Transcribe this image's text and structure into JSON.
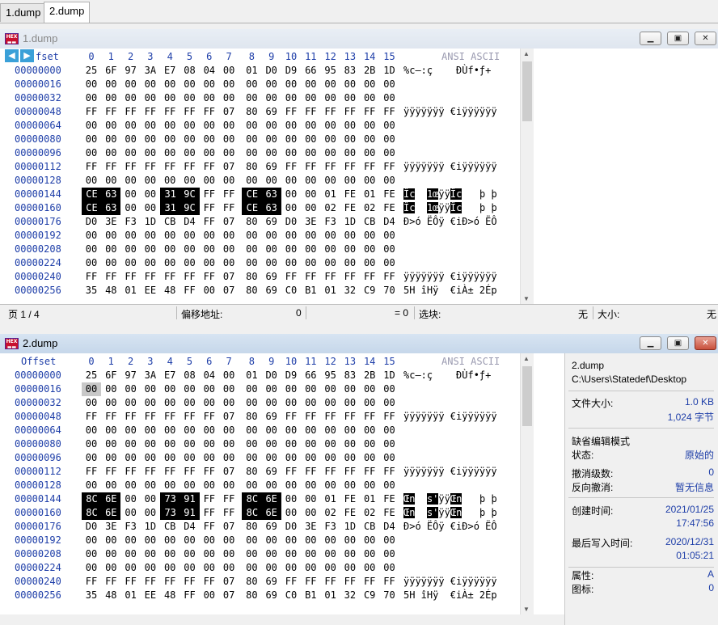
{
  "tabs": [
    "1.dump",
    "2.dump"
  ],
  "window1": {
    "title": "1.dump"
  },
  "window2": {
    "title": "2.dump"
  },
  "header": {
    "offset": "Offset",
    "columns": [
      "0",
      "1",
      "2",
      "3",
      "4",
      "5",
      "6",
      "7",
      "8",
      "9",
      "10",
      "11",
      "12",
      "13",
      "14",
      "15"
    ],
    "ascii": "ANSI ASCII"
  },
  "dump1": {
    "rows": [
      {
        "offset": "00000000",
        "hex": [
          "25",
          "6F",
          "97",
          "3A",
          "E7",
          "08",
          "04",
          "00",
          "01",
          "D0",
          "D9",
          "66",
          "95",
          "83",
          "2B",
          "1D"
        ],
        "ascii": "%c—:ç    ÐÙf•ƒ+ "
      },
      {
        "offset": "00000016",
        "hex": [
          "00",
          "00",
          "00",
          "00",
          "00",
          "00",
          "00",
          "00",
          "00",
          "00",
          "00",
          "00",
          "00",
          "00",
          "00",
          "00"
        ],
        "ascii": ""
      },
      {
        "offset": "00000032",
        "hex": [
          "00",
          "00",
          "00",
          "00",
          "00",
          "00",
          "00",
          "00",
          "00",
          "00",
          "00",
          "00",
          "00",
          "00",
          "00",
          "00"
        ],
        "ascii": ""
      },
      {
        "offset": "00000048",
        "hex": [
          "FF",
          "FF",
          "FF",
          "FF",
          "FF",
          "FF",
          "FF",
          "07",
          "80",
          "69",
          "FF",
          "FF",
          "FF",
          "FF",
          "FF",
          "FF"
        ],
        "ascii": "ÿÿÿÿÿÿÿ €iÿÿÿÿÿÿ"
      },
      {
        "offset": "00000064",
        "hex": [
          "00",
          "00",
          "00",
          "00",
          "00",
          "00",
          "00",
          "00",
          "00",
          "00",
          "00",
          "00",
          "00",
          "00",
          "00",
          "00"
        ],
        "ascii": ""
      },
      {
        "offset": "00000080",
        "hex": [
          "00",
          "00",
          "00",
          "00",
          "00",
          "00",
          "00",
          "00",
          "00",
          "00",
          "00",
          "00",
          "00",
          "00",
          "00",
          "00"
        ],
        "ascii": ""
      },
      {
        "offset": "00000096",
        "hex": [
          "00",
          "00",
          "00",
          "00",
          "00",
          "00",
          "00",
          "00",
          "00",
          "00",
          "00",
          "00",
          "00",
          "00",
          "00",
          "00"
        ],
        "ascii": ""
      },
      {
        "offset": "00000112",
        "hex": [
          "FF",
          "FF",
          "FF",
          "FF",
          "FF",
          "FF",
          "FF",
          "07",
          "80",
          "69",
          "FF",
          "FF",
          "FF",
          "FF",
          "FF",
          "FF"
        ],
        "ascii": "ÿÿÿÿÿÿÿ €iÿÿÿÿÿÿ"
      },
      {
        "offset": "00000128",
        "hex": [
          "00",
          "00",
          "00",
          "00",
          "00",
          "00",
          "00",
          "00",
          "00",
          "00",
          "00",
          "00",
          "00",
          "00",
          "00",
          "00"
        ],
        "ascii": ""
      },
      {
        "offset": "00000144",
        "hex": [
          "CE",
          "63",
          "00",
          "00",
          "31",
          "9C",
          "FF",
          "FF",
          "CE",
          "63",
          "00",
          "00",
          "01",
          "FE",
          "01",
          "FE"
        ],
        "ascii": "Îc  1œÿÿÎc   þ þ",
        "sel": [
          0,
          1,
          4,
          5,
          8,
          9
        ]
      },
      {
        "offset": "00000160",
        "hex": [
          "CE",
          "63",
          "00",
          "00",
          "31",
          "9C",
          "FF",
          "FF",
          "CE",
          "63",
          "00",
          "00",
          "02",
          "FE",
          "02",
          "FE"
        ],
        "ascii": "Îc  1œÿÿÎc   þ þ",
        "sel": [
          0,
          1,
          4,
          5,
          8,
          9
        ]
      },
      {
        "offset": "00000176",
        "hex": [
          "D0",
          "3E",
          "F3",
          "1D",
          "CB",
          "D4",
          "FF",
          "07",
          "80",
          "69",
          "D0",
          "3E",
          "F3",
          "1D",
          "CB",
          "D4"
        ],
        "ascii": "Ð>ó ËÔÿ €iÐ>ó ËÔ"
      },
      {
        "offset": "00000192",
        "hex": [
          "00",
          "00",
          "00",
          "00",
          "00",
          "00",
          "00",
          "00",
          "00",
          "00",
          "00",
          "00",
          "00",
          "00",
          "00",
          "00"
        ],
        "ascii": ""
      },
      {
        "offset": "00000208",
        "hex": [
          "00",
          "00",
          "00",
          "00",
          "00",
          "00",
          "00",
          "00",
          "00",
          "00",
          "00",
          "00",
          "00",
          "00",
          "00",
          "00"
        ],
        "ascii": ""
      },
      {
        "offset": "00000224",
        "hex": [
          "00",
          "00",
          "00",
          "00",
          "00",
          "00",
          "00",
          "00",
          "00",
          "00",
          "00",
          "00",
          "00",
          "00",
          "00",
          "00"
        ],
        "ascii": ""
      },
      {
        "offset": "00000240",
        "hex": [
          "FF",
          "FF",
          "FF",
          "FF",
          "FF",
          "FF",
          "FF",
          "07",
          "80",
          "69",
          "FF",
          "FF",
          "FF",
          "FF",
          "FF",
          "FF"
        ],
        "ascii": "ÿÿÿÿÿÿÿ €iÿÿÿÿÿÿ"
      },
      {
        "offset": "00000256",
        "hex": [
          "35",
          "48",
          "01",
          "EE",
          "48",
          "FF",
          "00",
          "07",
          "80",
          "69",
          "C0",
          "B1",
          "01",
          "32",
          "C9",
          "70"
        ],
        "ascii": "5H îHÿ  €iÀ± 2Ép"
      }
    ]
  },
  "dump2": {
    "rows": [
      {
        "offset": "00000000",
        "hex": [
          "25",
          "6F",
          "97",
          "3A",
          "E7",
          "08",
          "04",
          "00",
          "01",
          "D0",
          "D9",
          "66",
          "95",
          "83",
          "2B",
          "1D"
        ],
        "ascii": "%c—:ç    ÐÙf•ƒ+ "
      },
      {
        "offset": "00000016",
        "hex": [
          "00",
          "00",
          "00",
          "00",
          "00",
          "00",
          "00",
          "00",
          "00",
          "00",
          "00",
          "00",
          "00",
          "00",
          "00",
          "00"
        ],
        "ascii": "",
        "cursor": 0
      },
      {
        "offset": "00000032",
        "hex": [
          "00",
          "00",
          "00",
          "00",
          "00",
          "00",
          "00",
          "00",
          "00",
          "00",
          "00",
          "00",
          "00",
          "00",
          "00",
          "00"
        ],
        "ascii": ""
      },
      {
        "offset": "00000048",
        "hex": [
          "FF",
          "FF",
          "FF",
          "FF",
          "FF",
          "FF",
          "FF",
          "07",
          "80",
          "69",
          "FF",
          "FF",
          "FF",
          "FF",
          "FF",
          "FF"
        ],
        "ascii": "ÿÿÿÿÿÿÿ €iÿÿÿÿÿÿ"
      },
      {
        "offset": "00000064",
        "hex": [
          "00",
          "00",
          "00",
          "00",
          "00",
          "00",
          "00",
          "00",
          "00",
          "00",
          "00",
          "00",
          "00",
          "00",
          "00",
          "00"
        ],
        "ascii": ""
      },
      {
        "offset": "00000080",
        "hex": [
          "00",
          "00",
          "00",
          "00",
          "00",
          "00",
          "00",
          "00",
          "00",
          "00",
          "00",
          "00",
          "00",
          "00",
          "00",
          "00"
        ],
        "ascii": ""
      },
      {
        "offset": "00000096",
        "hex": [
          "00",
          "00",
          "00",
          "00",
          "00",
          "00",
          "00",
          "00",
          "00",
          "00",
          "00",
          "00",
          "00",
          "00",
          "00",
          "00"
        ],
        "ascii": ""
      },
      {
        "offset": "00000112",
        "hex": [
          "FF",
          "FF",
          "FF",
          "FF",
          "FF",
          "FF",
          "FF",
          "07",
          "80",
          "69",
          "FF",
          "FF",
          "FF",
          "FF",
          "FF",
          "FF"
        ],
        "ascii": "ÿÿÿÿÿÿÿ €iÿÿÿÿÿÿ"
      },
      {
        "offset": "00000128",
        "hex": [
          "00",
          "00",
          "00",
          "00",
          "00",
          "00",
          "00",
          "00",
          "00",
          "00",
          "00",
          "00",
          "00",
          "00",
          "00",
          "00"
        ],
        "ascii": ""
      },
      {
        "offset": "00000144",
        "hex": [
          "8C",
          "6E",
          "00",
          "00",
          "73",
          "91",
          "FF",
          "FF",
          "8C",
          "6E",
          "00",
          "00",
          "01",
          "FE",
          "01",
          "FE"
        ],
        "ascii": "Œn  s'ÿÿŒn   þ þ",
        "sel": [
          0,
          1,
          4,
          5,
          8,
          9
        ]
      },
      {
        "offset": "00000160",
        "hex": [
          "8C",
          "6E",
          "00",
          "00",
          "73",
          "91",
          "FF",
          "FF",
          "8C",
          "6E",
          "00",
          "00",
          "02",
          "FE",
          "02",
          "FE"
        ],
        "ascii": "Œn  s'ÿÿŒn   þ þ",
        "sel": [
          0,
          1,
          4,
          5,
          8,
          9
        ]
      },
      {
        "offset": "00000176",
        "hex": [
          "D0",
          "3E",
          "F3",
          "1D",
          "CB",
          "D4",
          "FF",
          "07",
          "80",
          "69",
          "D0",
          "3E",
          "F3",
          "1D",
          "CB",
          "D4"
        ],
        "ascii": "Ð>ó ËÔÿ €iÐ>ó ËÔ"
      },
      {
        "offset": "00000192",
        "hex": [
          "00",
          "00",
          "00",
          "00",
          "00",
          "00",
          "00",
          "00",
          "00",
          "00",
          "00",
          "00",
          "00",
          "00",
          "00",
          "00"
        ],
        "ascii": ""
      },
      {
        "offset": "00000208",
        "hex": [
          "00",
          "00",
          "00",
          "00",
          "00",
          "00",
          "00",
          "00",
          "00",
          "00",
          "00",
          "00",
          "00",
          "00",
          "00",
          "00"
        ],
        "ascii": ""
      },
      {
        "offset": "00000224",
        "hex": [
          "00",
          "00",
          "00",
          "00",
          "00",
          "00",
          "00",
          "00",
          "00",
          "00",
          "00",
          "00",
          "00",
          "00",
          "00",
          "00"
        ],
        "ascii": ""
      },
      {
        "offset": "00000240",
        "hex": [
          "FF",
          "FF",
          "FF",
          "FF",
          "FF",
          "FF",
          "FF",
          "07",
          "80",
          "69",
          "FF",
          "FF",
          "FF",
          "FF",
          "FF",
          "FF"
        ],
        "ascii": "ÿÿÿÿÿÿÿ €iÿÿÿÿÿÿ"
      },
      {
        "offset": "00000256",
        "hex": [
          "35",
          "48",
          "01",
          "EE",
          "48",
          "FF",
          "00",
          "07",
          "80",
          "69",
          "C0",
          "B1",
          "01",
          "32",
          "C9",
          "70"
        ],
        "ascii": "5H îHÿ  €iÀ± 2Ép"
      }
    ]
  },
  "status1": {
    "page": "页 1 / 4",
    "offset_label": "偏移地址:",
    "offset_value": "0",
    "eq": "= 0",
    "block_label": "选块:",
    "block_value": "无",
    "size_label": "大小:",
    "size_value": "无"
  },
  "info": {
    "filename": "2.dump",
    "path": "C:\\Users\\Statedef\\Desktop",
    "size_label": "文件大小:",
    "size_kb": "1.0 KB",
    "size_bytes": "1,024 字节",
    "mode_title": "缺省编辑模式",
    "state_label": "状态:",
    "state_value": "原始的",
    "undo_label": "撤消级数:",
    "undo_value": "0",
    "redo_label": "反向撤消:",
    "redo_value": "暂无信息",
    "created_label": "创建时间:",
    "created_date": "2021/01/25",
    "created_time": "17:47:56",
    "modified_label": "最后写入时间:",
    "modified_date": "2020/12/31",
    "modified_time": "01:05:21",
    "attr_label": "属性:",
    "attr_value": "A",
    "icon_label": "图标:",
    "icon_value": "0"
  }
}
